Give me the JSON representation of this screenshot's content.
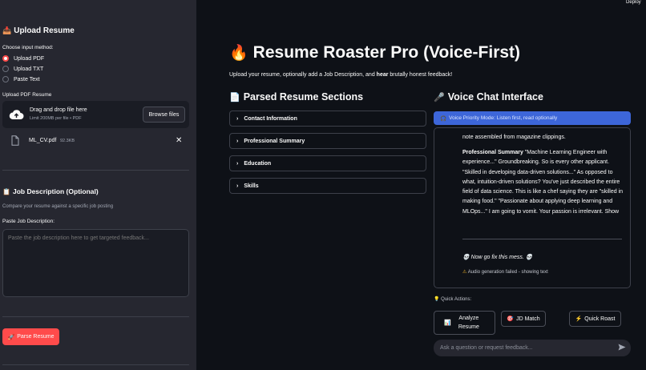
{
  "app": {
    "deploy_label": "Deploy"
  },
  "sidebar": {
    "upload_heading": "Upload Resume",
    "input_method_label": "Choose input method:",
    "options": [
      "Upload PDF",
      "Upload TXT",
      "Paste Text"
    ],
    "selected_option": "Upload PDF",
    "upload_label": "Upload PDF Resume",
    "dropzone_title": "Drag and drop file here",
    "dropzone_limit": "Limit 200MB per file • PDF",
    "browse_label": "Browse files",
    "file_name": "ML_CV.pdf",
    "file_size": "92.3KB",
    "jd_heading": "Job Description (Optional)",
    "jd_caption": "Compare your resume against a specific job posting",
    "jd_field_label": "Paste Job Description:",
    "jd_placeholder": "Paste the job description here to get targeted feedback...",
    "parse_label": "Parse Resume"
  },
  "main": {
    "title": "Resume Roaster Pro (Voice-First)",
    "subtitle_pre": "Upload your resume, optionally add a Job Description, and ",
    "subtitle_bold": "hear",
    "subtitle_post": " brutally honest feedback!",
    "parsed_heading": "Parsed Resume Sections",
    "sections": [
      "Contact Information",
      "Professional Summary",
      "Education",
      "Skills"
    ],
    "voice_heading": "Voice Chat Interface",
    "info_text": "Voice Priority Mode: Listen first, read optionally",
    "chat_line_top": "note assembled from magazine clippings.",
    "chat_summary_label": "Professional Summary",
    "chat_summary_text": " \"Machine Learning Engineer with experience...\" Groundbreaking. So is every other applicant. \"Skilled in developing data-driven solutions...\" As opposed to what, intuition-driven solutions? You've just described the entire field of data science. This is like a chef saying they are \"skilled in making food.\" \"Passionate about applying deep learning and MLOps...\" I am going to vomit. Your passion is irrelevant. Show",
    "fix_text": "Now go fix this mess.",
    "audio_warning": "Audio generation failed - showing text",
    "quick_actions_label": "Quick Actions:",
    "actions": {
      "analyze": "Analyze Resume",
      "jd_match": "JD Match",
      "quick_roast": "Quick Roast"
    },
    "chat_placeholder": "Ask a question or request feedback..."
  },
  "colors": {
    "accent": "#ff4b4b",
    "info": "#3d66d9",
    "sidebar": "#262730",
    "background": "#0e1117"
  }
}
